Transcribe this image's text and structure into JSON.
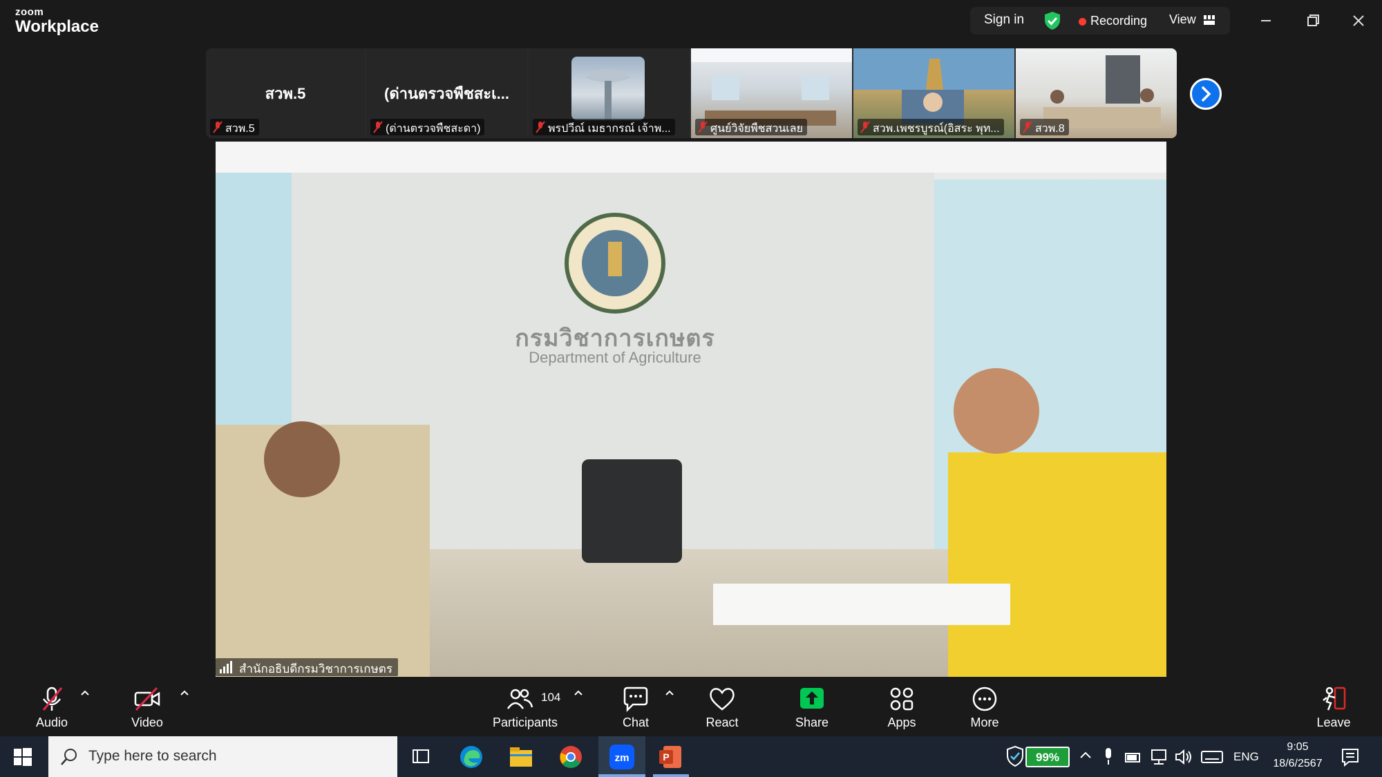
{
  "app": {
    "logo_small": "zoom",
    "logo_big": "Workplace"
  },
  "titlebar": {
    "sign_in": "Sign in",
    "recording": "Recording",
    "view": "View",
    "colors": {
      "recording_dot": "#ff3b30",
      "shield": "#22c55e"
    }
  },
  "gallery": {
    "tiles": [
      {
        "big_name": "สวพ.5",
        "label": "สวพ.5"
      },
      {
        "big_name": "(ด่านตรวจพืชสะเ...",
        "label": "(ด่านตรวจพืชสะดา)"
      },
      {
        "label": "พรปวีณ์  เมธากรณ์ เจ้าพ..."
      },
      {
        "label": "ศูนย์วิจัยพืชสวนเลย"
      },
      {
        "label": "สวพ.เพชรบูรณ์(อิสระ พุท..."
      },
      {
        "label": "สวพ.8"
      }
    ]
  },
  "main_video": {
    "speaker": "สำนักอธิบดีกรมวิชาการเกษตร",
    "wall_text_th": "กรมวิชาการเกษตร",
    "wall_text_en": "Department of Agriculture"
  },
  "toolbar": {
    "audio": "Audio",
    "video": "Video",
    "participants": "Participants",
    "participants_count": "104",
    "chat": "Chat",
    "react": "React",
    "share": "Share",
    "apps": "Apps",
    "more": "More",
    "leave": "Leave",
    "colors": {
      "share": "#00c853",
      "leave": "#e02828",
      "muted": "#e02848"
    }
  },
  "taskbar": {
    "search_placeholder": "Type here to search",
    "battery": "99%",
    "language": "ENG",
    "time": "9:05",
    "date": "18/6/2567"
  }
}
